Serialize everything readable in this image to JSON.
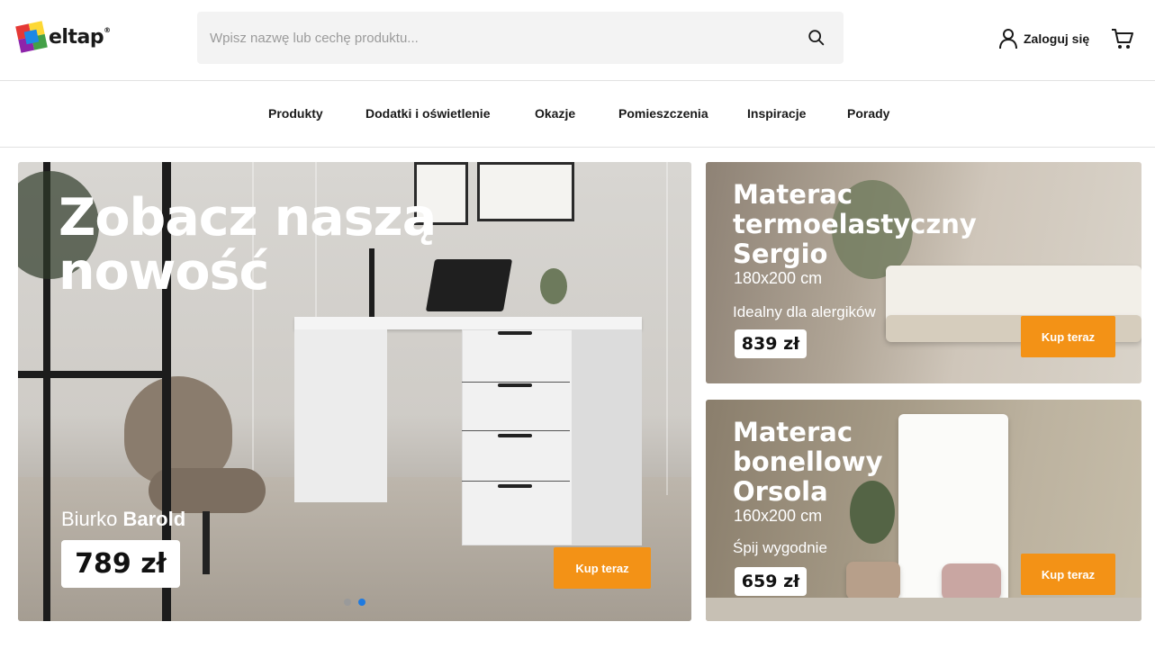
{
  "brand": {
    "name": "eltap",
    "mark": "®"
  },
  "search": {
    "placeholder": "Wpisz nazwę lub cechę produktu...",
    "value": ""
  },
  "header": {
    "login_label": "Zaloguj się"
  },
  "icons": {
    "search": "search-icon",
    "user": "user-icon",
    "cart": "cart-icon"
  },
  "nav": {
    "items": [
      {
        "label": "Produkty"
      },
      {
        "label": "Dodatki i oświetlenie"
      },
      {
        "label": "Okazje"
      },
      {
        "label": "Pomieszczenia"
      },
      {
        "label": "Inspiracje"
      },
      {
        "label": "Porady"
      }
    ]
  },
  "hero": {
    "title": "Zobacz naszą nowość",
    "product_prefix": "Biurko",
    "product_name": "Barold",
    "price": "789 zł",
    "cta": "Kup teraz",
    "slides": 2,
    "active_slide": 2
  },
  "promos": [
    {
      "title": "Materac termoelastyczny Sergio",
      "size": "180x200 cm",
      "subtitle": "Idealny dla alergików",
      "price": "839 zł",
      "cta": "Kup teraz"
    },
    {
      "title": "Materac bonellowy Orsola",
      "size": "160x200 cm",
      "subtitle": "Śpij wygodnie",
      "price": "659 zł",
      "cta": "Kup teraz"
    }
  ],
  "colors": {
    "accent": "#f39216",
    "active_dot": "#1e7ae0",
    "text": "#1a1a1a"
  }
}
